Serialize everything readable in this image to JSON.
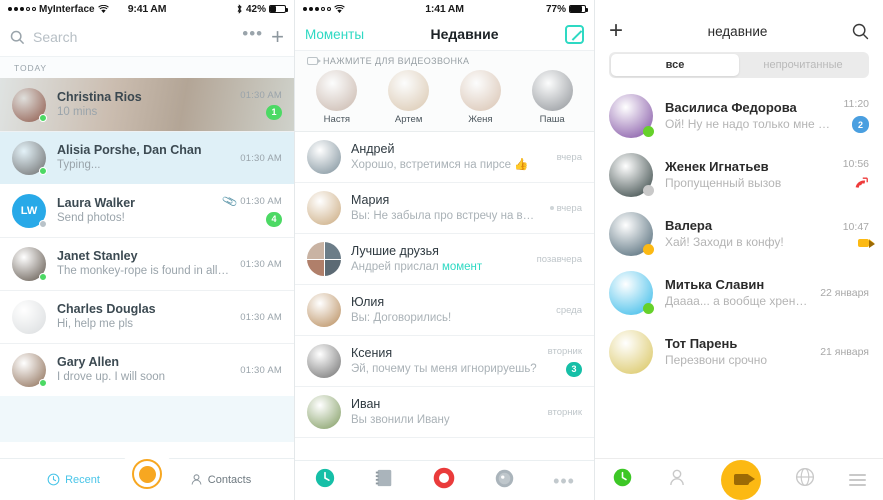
{
  "panel1": {
    "status": {
      "carrier": "MyInterface",
      "time": "9:41 AM",
      "battery": "42%"
    },
    "search_placeholder": "Search",
    "section_today": "TODAY",
    "tabs": [
      {
        "label": "Recent",
        "icon": "clock-icon",
        "active": true
      },
      {
        "label": "Contacts",
        "icon": "person-icon",
        "active": false
      }
    ],
    "fab_icon": "call-fab-icon",
    "rows": [
      {
        "name": "Christina Rios",
        "sub": "10 mins",
        "time": "01:30 AM",
        "badge": "1",
        "badge_color": "#4cd964",
        "presence": "#4cd964",
        "style": "photo",
        "avatar": "#8f5a4c",
        "attach": false
      },
      {
        "name": "Alisia Porshe, Dan Chan",
        "sub": "Typing...",
        "time": "01:30 AM",
        "badge": "",
        "badge_color": "",
        "presence": "#4cd964",
        "style": "selected",
        "avatar": "#6b6b6b",
        "attach": false
      },
      {
        "name": "Laura Walker",
        "sub": "Send photos!",
        "time": "01:30 AM",
        "badge": "4",
        "badge_color": "#4cd964",
        "presence": "#b9c3c9",
        "style": "plain",
        "avatar": "#28a9e8",
        "initials": "LW",
        "attach": true
      },
      {
        "name": "Janet Stanley",
        "sub": "The monkey-rope is found in all whalers...",
        "time": "01:30 AM",
        "badge": "",
        "badge_color": "",
        "presence": "#4cd964",
        "style": "plain",
        "avatar": "#5c5248",
        "attach": false
      },
      {
        "name": "Charles Douglas",
        "sub": "Hi, help me pls",
        "time": "01:30 AM",
        "badge": "",
        "badge_color": "",
        "presence": "",
        "style": "plain",
        "avatar": "#d9dcde",
        "attach": false
      },
      {
        "name": "Gary Allen",
        "sub": "I drove up. I will soon",
        "time": "01:30 AM",
        "badge": "",
        "badge_color": "",
        "presence": "#4cd964",
        "style": "plain",
        "avatar": "#8a6a52",
        "attach": false
      }
    ]
  },
  "panel2": {
    "status": {
      "carrier": "",
      "time": "1:41 AM",
      "battery": "77%"
    },
    "nav": {
      "back": "Моменты",
      "title": "Недавние",
      "edit_icon": "compose-icon"
    },
    "videocall": {
      "header": "НАЖМИТЕ ДЛЯ ВИДЕОЗВОНКА",
      "people": [
        {
          "name": "Настя",
          "avatar": "#c8b6ab"
        },
        {
          "name": "Артем",
          "avatar": "#d9c6ae"
        },
        {
          "name": "Женя",
          "avatar": "#d8c2b0"
        },
        {
          "name": "Паша",
          "avatar": "#8f9398"
        }
      ]
    },
    "rows": [
      {
        "name": "Андрей",
        "sub": "Хорошо, встретимся на пирсе 👍",
        "time": "вчера",
        "dot": false,
        "badge": "",
        "avatar": "#7b8e99",
        "type": "single"
      },
      {
        "name": "Мария",
        "sub": "Вы: Не забыла про встречу на выходных?",
        "time": "вчера",
        "dot": true,
        "badge": "",
        "avatar": "#c9a87c",
        "type": "single"
      },
      {
        "name": "Лучшие друзья",
        "sub": "Андрей прислал ",
        "sub_hl": "момент",
        "time": "позавчера",
        "dot": false,
        "badge": "",
        "avatar": "#9aa6ae",
        "type": "group"
      },
      {
        "name": "Юлия",
        "sub": "Вы: Договорились!",
        "time": "среда",
        "dot": false,
        "badge": "",
        "avatar": "#b78b5a",
        "type": "single"
      },
      {
        "name": "Ксения",
        "sub": "Эй, почему ты меня игнорируешь?",
        "time": "вторник",
        "dot": false,
        "badge": "3",
        "badge_color": "#16bfa7",
        "avatar": "#6e6e6e",
        "type": "single"
      },
      {
        "name": "Иван",
        "sub": "Вы звонили Ивану",
        "time": "вторник",
        "dot": false,
        "badge": "",
        "avatar": "#7e9a5e",
        "type": "single"
      }
    ],
    "tabs": [
      {
        "icon": "clock-icon",
        "active": true,
        "color": "#16bfa7"
      },
      {
        "icon": "notebook-icon",
        "active": false,
        "color": "#aab4bb"
      },
      {
        "icon": "record-icon",
        "active": false,
        "color": "#ea3b3b"
      },
      {
        "icon": "compass-icon",
        "active": false,
        "color": "#aab4bb"
      },
      {
        "icon": "more-icon",
        "active": false,
        "color": "#c2c9cd"
      }
    ]
  },
  "panel3": {
    "nav": {
      "plus_icon": "plus-icon",
      "title": "недавние",
      "search_icon": "search-icon"
    },
    "segments": [
      {
        "label": "все",
        "active": true
      },
      {
        "label": "непрочитанные",
        "active": false
      }
    ],
    "rows": [
      {
        "name": "Василиса Федорова",
        "sub": "Ой! Ну не надо только мне ра...",
        "time": "11:20",
        "badge": "2",
        "badge_color": "#4a9fe0",
        "presence": "#66d12a",
        "avatar": "#7c4ba0",
        "right_icon": ""
      },
      {
        "name": "Женек Игнатьев",
        "sub": "Пропущенный вызов",
        "time": "10:56",
        "badge": "",
        "presence": "#c9c9c9",
        "avatar": "#2b3b3a",
        "right_icon": "missed-call-icon",
        "right_color": "#ee3b3b"
      },
      {
        "name": "Валера",
        "sub": "Хай! Заходи в конфу!",
        "time": "10:47",
        "badge": "",
        "presence": "#fcb913",
        "avatar": "#45606f",
        "right_icon": "video-icon",
        "right_color": "#fcb913"
      },
      {
        "name": "Митька Славин",
        "sub": "Дааaa... а вообще хрен его знает...",
        "time": "22 января",
        "badge": "",
        "presence": "#66d12a",
        "avatar": "#2fb7e8",
        "right_icon": ""
      },
      {
        "name": "Тот Парень",
        "sub": "Перезвони срочно",
        "time": "21 января",
        "badge": "",
        "presence": "",
        "avatar": "#d8c35a",
        "right_icon": ""
      }
    ],
    "tabs": [
      {
        "icon": "clock-icon",
        "active": true,
        "color": "#3dc726"
      },
      {
        "icon": "person-icon",
        "active": false,
        "color": "#c9c9c9"
      },
      {
        "icon": "video-fab-icon",
        "active": true,
        "color": "#fcb913"
      },
      {
        "icon": "globe-icon",
        "active": false,
        "color": "#c9c9c9"
      },
      {
        "icon": "menu-icon",
        "active": false,
        "color": "#c9c9c9"
      }
    ]
  }
}
